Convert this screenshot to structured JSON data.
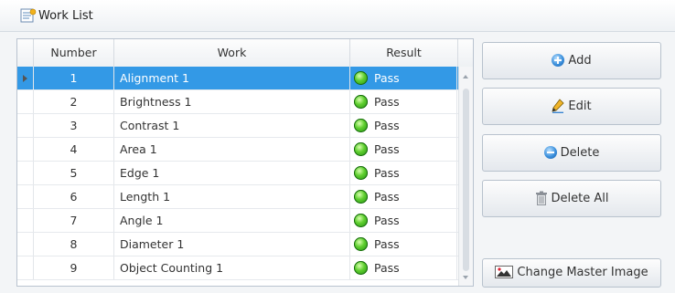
{
  "window": {
    "title": "Work List"
  },
  "grid": {
    "columns": {
      "number": "Number",
      "work": "Work",
      "result": "Result"
    },
    "rows": [
      {
        "number": "1",
        "work": "Alignment 1",
        "result": "Pass"
      },
      {
        "number": "2",
        "work": "Brightness 1",
        "result": "Pass"
      },
      {
        "number": "3",
        "work": "Contrast 1",
        "result": "Pass"
      },
      {
        "number": "4",
        "work": "Area 1",
        "result": "Pass"
      },
      {
        "number": "5",
        "work": "Edge 1",
        "result": "Pass"
      },
      {
        "number": "6",
        "work": "Length 1",
        "result": "Pass"
      },
      {
        "number": "7",
        "work": "Angle 1",
        "result": "Pass"
      },
      {
        "number": "8",
        "work": "Diameter 1",
        "result": "Pass"
      },
      {
        "number": "9",
        "work": "Object Counting 1",
        "result": "Pass"
      }
    ],
    "selected_row": 1,
    "result_icon": "green-status-icon"
  },
  "buttons": {
    "add": "Add",
    "edit": "Edit",
    "delete": "Delete",
    "delete_all": "Delete All",
    "change_master_image": "Change Master Image"
  },
  "colors": {
    "selection": "#3399e6",
    "pass": "#3fb51f",
    "accent": "#2f7fd1"
  }
}
